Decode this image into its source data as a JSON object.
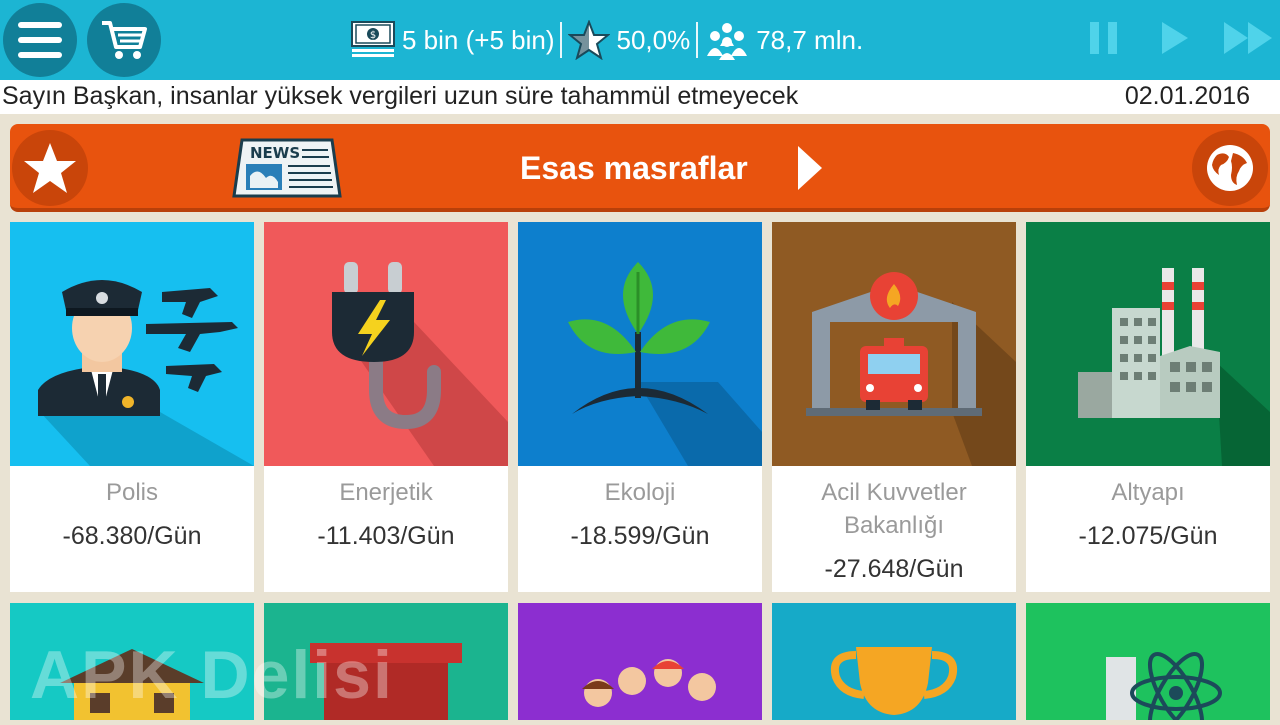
{
  "topbar": {
    "money": "5 bin (+5 bin)",
    "rating": "50,0%",
    "population": "78,7 mln."
  },
  "message": "Sayın Başkan, insanlar yüksek vergileri uzun süre tahammül etmeyecek",
  "date": "02.01.2016",
  "header": {
    "title": "Esas masraflar",
    "news_label": "NEWS"
  },
  "categories": [
    {
      "name": "Polis",
      "cost": "-68.380/Gün",
      "color": "#16bff0"
    },
    {
      "name": "Enerjetik",
      "cost": "-11.403/Gün",
      "color": "#f0595a"
    },
    {
      "name": "Ekoloji",
      "cost": "-18.599/Gün",
      "color": "#0d7fcd"
    },
    {
      "name": "Acil Kuvvetler Bakanlığı",
      "cost": "-27.648/Gün",
      "color": "#8f5a23"
    },
    {
      "name": "Altyapı",
      "cost": "-12.075/Gün",
      "color": "#0a7f46"
    }
  ],
  "bottom_colors": [
    "#15c9c4",
    "#1bb48f",
    "#8c2ed0",
    "#16aac8",
    "#1ec25e"
  ],
  "watermark": "APK Delisi",
  "colors": {
    "topbar": "#1cb5d3",
    "header": "#e8530e",
    "background": "#e9e3d3"
  }
}
